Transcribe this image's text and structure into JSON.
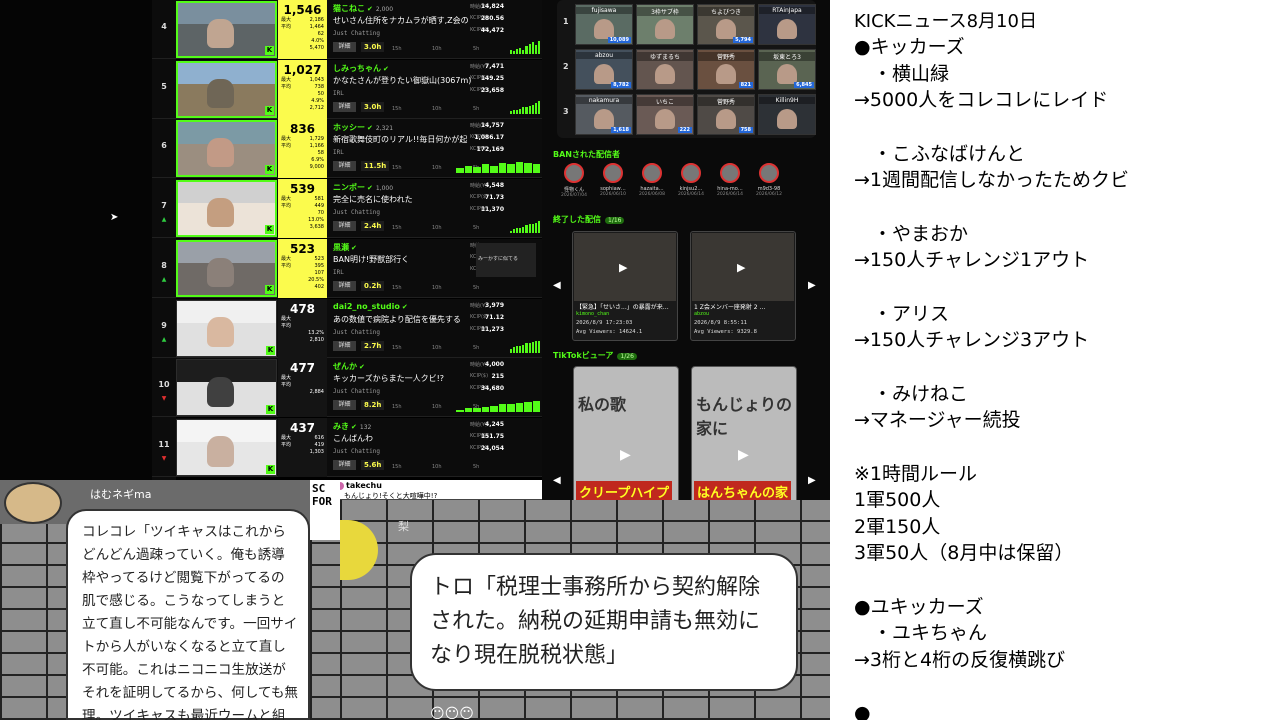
{
  "ranking": [
    {
      "rank": "4",
      "dir": "",
      "name": "猫こねこ",
      "followers": "2,000",
      "title": "せいさん住所をナカムラが晒す,Z会の",
      "category": "Just Chatting",
      "duration": "3.0h",
      "viewers": "1,546",
      "max": "2,186",
      "avg": "1,464",
      "stat3": "62",
      "pct": "4.0%",
      "stat5": "5,470",
      "m1": "14,824",
      "m2": "280.56",
      "m3": "44,472",
      "thumb": [
        "#7a8f9e",
        "#5d6466",
        "#c0a591"
      ],
      "spark": [
        3,
        2,
        4,
        5,
        3,
        6,
        8,
        9,
        7,
        10
      ]
    },
    {
      "rank": "5",
      "dir": "",
      "name": "しみっちゃん",
      "followers": "",
      "title": "かなたさんが登りたい御嶽山(3067m)",
      "category": "IRL",
      "duration": "3.0h",
      "viewers": "1,027",
      "max": "1,043",
      "avg": "738",
      "stat3": "50",
      "pct": "4.9%",
      "stat5": "2,712",
      "m1": "7,471",
      "m2": "149.25",
      "m3": "23,658",
      "thumb": [
        "#8fb0cf",
        "#8a7a5e",
        "#6f6656"
      ],
      "spark": [
        2,
        3,
        3,
        4,
        5,
        5,
        6,
        7,
        8,
        10
      ]
    },
    {
      "rank": "6",
      "dir": "",
      "name": "ホッシー",
      "followers": "2,321",
      "title": "新宿歌舞伎町のリアル!!毎日何かが起",
      "category": "IRL",
      "duration": "11.5h",
      "viewers": "836",
      "max": "1,729",
      "avg": "1,166",
      "stat3": "58",
      "pct": "6.9%",
      "stat5": "9,000",
      "m1": "14,757",
      "m2": "1,086.17",
      "m3": "172,169",
      "thumb": [
        "#7c9aa5",
        "#9b8e80",
        "#c29a86"
      ],
      "spark": [
        4,
        6,
        5,
        7,
        6,
        8,
        7,
        9,
        8,
        7
      ],
      "wide": true
    },
    {
      "rank": "7",
      "dir": "up",
      "name": "ニンポー",
      "followers": "1,000",
      "title": "完全に売名に使われた",
      "category": "Just Chatting",
      "duration": "2.4h",
      "viewers": "539",
      "max": "581",
      "avg": "449",
      "stat3": "70",
      "pct": "13.0%",
      "stat5": "3,638",
      "m1": "4,548",
      "m2": "71.73",
      "m3": "11,370",
      "thumb": [
        "#d0d0d0",
        "#ece3d8",
        "#c49e80"
      ],
      "spark": [
        2,
        3,
        4,
        4,
        5,
        6,
        7,
        7,
        8,
        9
      ]
    },
    {
      "rank": "8",
      "dir": "up",
      "name": "黒瀬",
      "followers": "",
      "title": "BAN明け!野獣部行く",
      "category": "IRL",
      "duration": "0.2h",
      "viewers": "523",
      "max": "523",
      "avg": "395",
      "stat3": "107",
      "pct": "20.5%",
      "stat5": "402",
      "m1": "",
      "m2": "",
      "m3": "",
      "thumb": [
        "#9aa0a8",
        "#6f6a66",
        "#8b8079"
      ],
      "spark": [],
      "tag": "みーかすに似てる"
    },
    {
      "rank": "9",
      "dir": "up",
      "name": "dai2_no_studio",
      "followers": "",
      "title": "あの数値で病院より配信を優先する",
      "category": "Just Chatting",
      "duration": "2.7h",
      "viewers": "478",
      "max": "",
      "avg": "",
      "stat3": "",
      "pct": "13.2%",
      "stat5": "2,810",
      "m1": "3,979",
      "m2": "71.12",
      "m3": "11,273",
      "thumb": [
        "#f0f0f0",
        "#e0e0e0",
        "#d9b8a0"
      ],
      "spark": [
        3,
        4,
        5,
        5,
        6,
        7,
        7,
        8,
        9,
        9
      ],
      "dark": true
    },
    {
      "rank": "10",
      "dir": "dn",
      "name": "ぜんか",
      "followers": "",
      "title": "キッカーズからまた一人クビ!?",
      "category": "Just Chatting",
      "duration": "8.2h",
      "viewers": "477",
      "max": "",
      "avg": "",
      "stat3": "",
      "pct": "",
      "stat5": "2,884",
      "m1": "4,000",
      "m2": "215",
      "m3": "34,680",
      "thumb": [
        "#1d1d1d",
        "#e0e0e0",
        "#404040"
      ],
      "spark": [
        2,
        3,
        3,
        4,
        5,
        6,
        6,
        7,
        8,
        9
      ],
      "wide": true,
      "dark": true
    },
    {
      "rank": "11",
      "dir": "dn",
      "name": "みき",
      "followers": "132",
      "title": "こんばんわ",
      "category": "Just Chatting",
      "duration": "5.6h",
      "viewers": "437",
      "max": "616",
      "avg": "419",
      "stat3": "",
      "pct": "",
      "stat5": "1,303",
      "m1": "4,245",
      "m2": "151.75",
      "m3": "24,054",
      "thumb": [
        "#f4f4f4",
        "#e6e6e6",
        "#c9b0a0"
      ],
      "spark": [],
      "dark": true
    }
  ],
  "labels": {
    "max": "最大",
    "avg": "平均",
    "detail": "詳細",
    "t15": "15h",
    "t10": "10h",
    "t5": "5h",
    "m1": "時給(¥)",
    "m2": "KCIP($)",
    "m3": "KCIP(¥)",
    "k": "K"
  },
  "top3": [
    {
      "rank": "1",
      "cells": [
        {
          "name": "fujisawa",
          "views": "10,089",
          "bg": "#5a6b63"
        },
        {
          "name": "3枠サブ枠",
          "views": "",
          "bg": "#6d7f6c"
        },
        {
          "name": "ちよびつき",
          "views": "5,794",
          "bg": "#5b564c"
        },
        {
          "name": "RTAinJapa",
          "views": "",
          "bg": "#2e3340"
        }
      ]
    },
    {
      "rank": "2",
      "cells": [
        {
          "name": "abzou",
          "views": "8,782",
          "bg": "#44505c"
        },
        {
          "name": "ゆずまるち",
          "views": "",
          "bg": "#63554f"
        },
        {
          "name": "菅野秀",
          "views": "821",
          "bg": "#6a5040"
        },
        {
          "name": "坂東とろ3",
          "views": "6,845",
          "bg": "#5a6452"
        }
      ]
    },
    {
      "rank": "3",
      "cells": [
        {
          "name": "nakamura",
          "views": "1,618",
          "bg": "#555a60"
        },
        {
          "name": "いちこ",
          "views": "222",
          "bg": "#6a5a55"
        },
        {
          "name": "菅野秀",
          "views": "758",
          "bg": "#4f4a46"
        },
        {
          "name": "Killin9H",
          "views": "",
          "bg": "#2d3136"
        }
      ]
    }
  ],
  "ban_title": "BANされた配信者",
  "banned": [
    {
      "name": "怪物くん",
      "date": "2026/07/04"
    },
    {
      "name": "sophiaw…",
      "date": "2026/06/10"
    },
    {
      "name": "hazaita…",
      "date": "2026/06/08"
    },
    {
      "name": "kinjsu2…",
      "date": "2026/06/14"
    },
    {
      "name": "hina-mo…",
      "date": "2026/06/14"
    },
    {
      "name": "m9d3-98",
      "date": "2026/06/12"
    }
  ],
  "ended_title": "終了した配信",
  "ended_pill": "1/16",
  "ended": [
    {
      "title": "【緊急】「せいさ...」の暴露が来…",
      "streamer": "kimono_chan",
      "date": "2026/8/9 17:23:03",
      "avg": "Avg Viewers: 14624.1"
    },
    {
      "title": "1 Z会メンバー座発射 2 …",
      "streamer": "abzou",
      "date": "2026/8/9 8:55:11",
      "avg": "Avg Viewers: 9329.8"
    }
  ],
  "tiktok_title": "TikTokビューア",
  "tiktok_pill": "1/26",
  "tiktok": [
    {
      "text": "私の歌",
      "banner": "クリープハイプ"
    },
    {
      "text": "もんじょりの家に",
      "banner": "はんちゃんの家"
    }
  ],
  "news": {
    "title": "KICKニュース8月10日",
    "lines": [
      "●キッカーズ",
      "　・横山緑",
      "→5000人をコレコレにレイド",
      "",
      "　・こふなばけんと",
      "→1週間配信しなかったためクビ",
      "",
      "　・やまおか",
      "→150人チャレンジ1アウト",
      "",
      "　・アリス",
      "→150人チャレンジ3アウト",
      "",
      "　・みけねこ",
      "→マネージャー続投",
      "",
      "※1時間ルール",
      "1軍500人",
      "2軍150人",
      "3軍50人（8月中は保留）",
      "",
      "●ユキッカーズ",
      "　・ユキちゃん",
      "→3桁と4桁の反復横跳び",
      "",
      "●"
    ]
  },
  "chat1": {
    "name": "はむネギma",
    "text": "コレコレ「ツイキャスはこれからどんどん過疎っていく。俺も誘導枠やってるけど閲覧下がってるの肌で感じる。こうなってしまうと立て直し不可能なんです。一回サイトから人がいなくなると立て直し不可能。これはニコニコ生放送がそれを証明してるから、何しても無理。ツイキャスも最近ウームと組んだけどあ"
  },
  "chat2": {
    "name": "梨",
    "text": "トロ「税理士事務所から契約解除された。納税の延期申請も無効になり現在脱税状態」"
  },
  "strip": {
    "name": "takechu",
    "text": "もんじょり!そくと大喧嘩中!?",
    "side": "SC FOR"
  },
  "emoji": "😶😶😶"
}
